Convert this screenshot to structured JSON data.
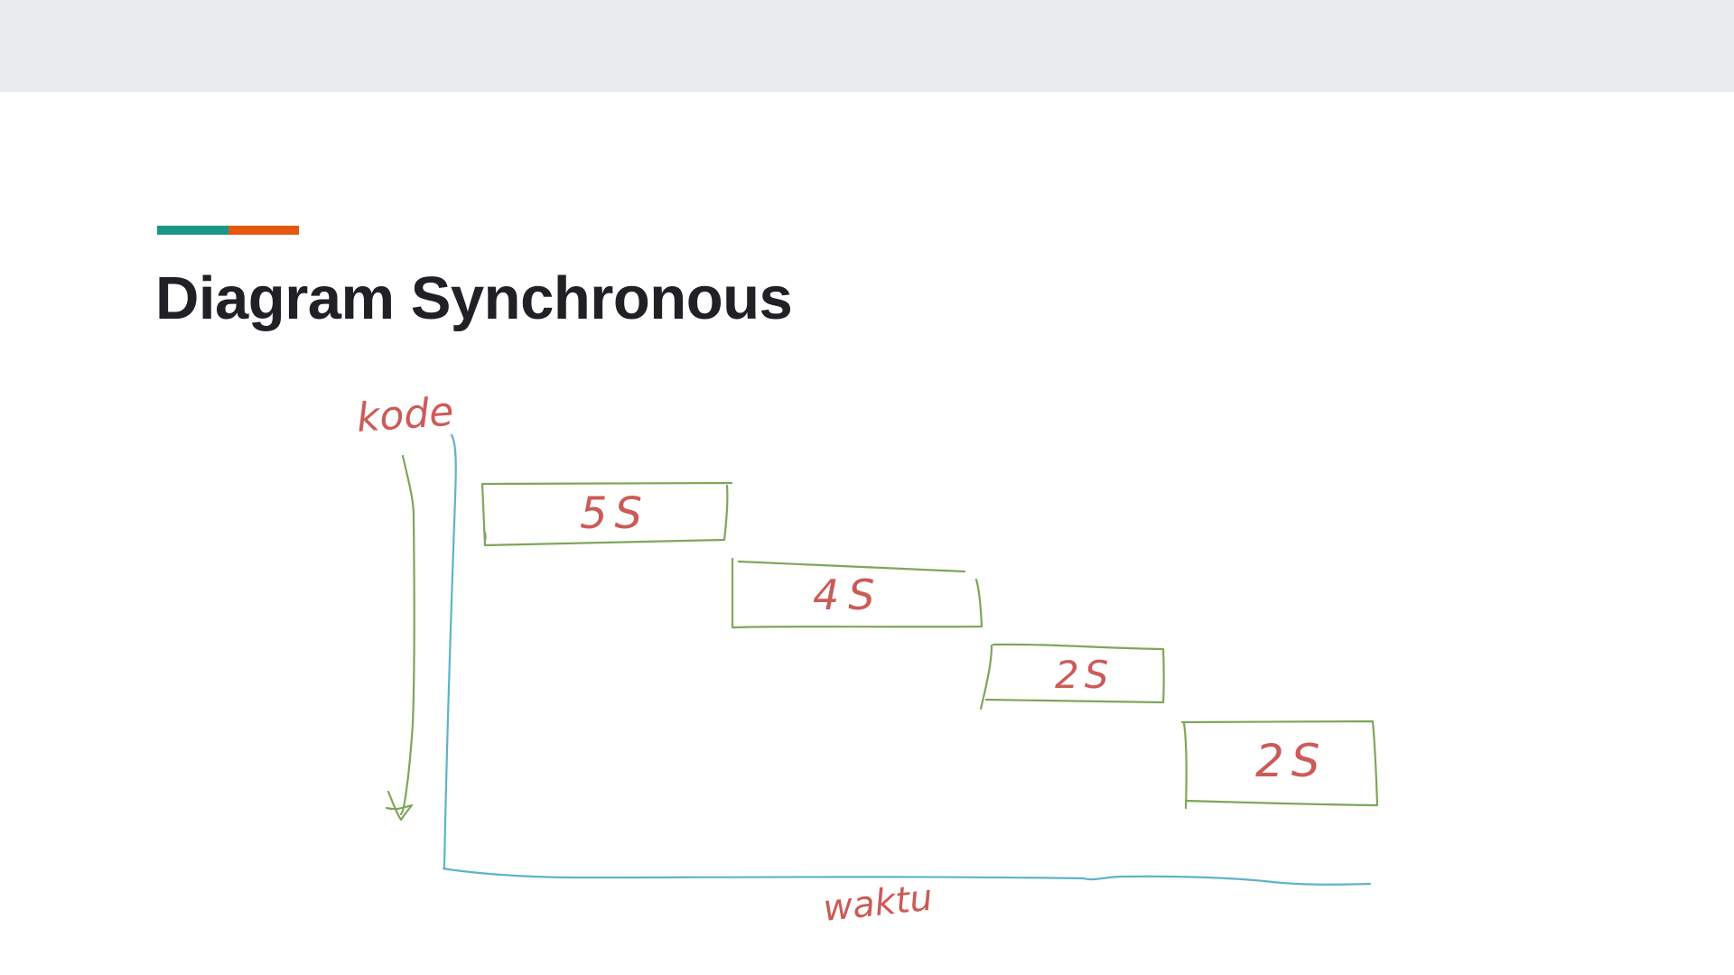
{
  "slide": {
    "title": "Diagram Synchronous",
    "accent_colors": [
      "#1b9688",
      "#e4570f"
    ]
  },
  "diagram": {
    "y_axis_label": "kode",
    "x_axis_label": "waktu",
    "tasks": [
      {
        "label": "5S"
      },
      {
        "label": "4S"
      },
      {
        "label": "2S"
      },
      {
        "label": "2S"
      }
    ],
    "colors": {
      "axis": "#5fb3c8",
      "box": "#7fa65a",
      "text": "#cc5b58",
      "arrow": "#7fa65a"
    }
  }
}
